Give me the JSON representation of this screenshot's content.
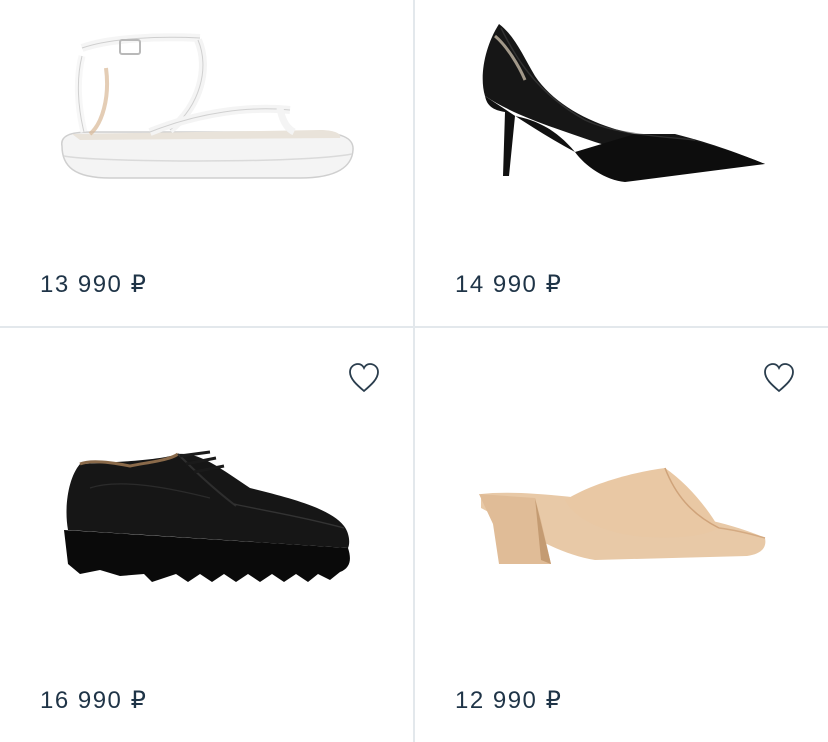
{
  "products": [
    {
      "price": "13 990 ₽",
      "image": "white-strappy-sandal",
      "favorite_icon": false
    },
    {
      "price": "14 990 ₽",
      "image": "black-pointed-pump",
      "favorite_icon": false
    },
    {
      "price": "16 990 ₽",
      "image": "black-lug-sole-derby",
      "favorite_icon": true
    },
    {
      "price": "12 990 ₽",
      "image": "beige-block-heel-mule",
      "favorite_icon": true
    }
  ],
  "colors": {
    "price_text": "#1f3447",
    "divider": "#e3e8ec",
    "icon": "#2a3d4d"
  }
}
